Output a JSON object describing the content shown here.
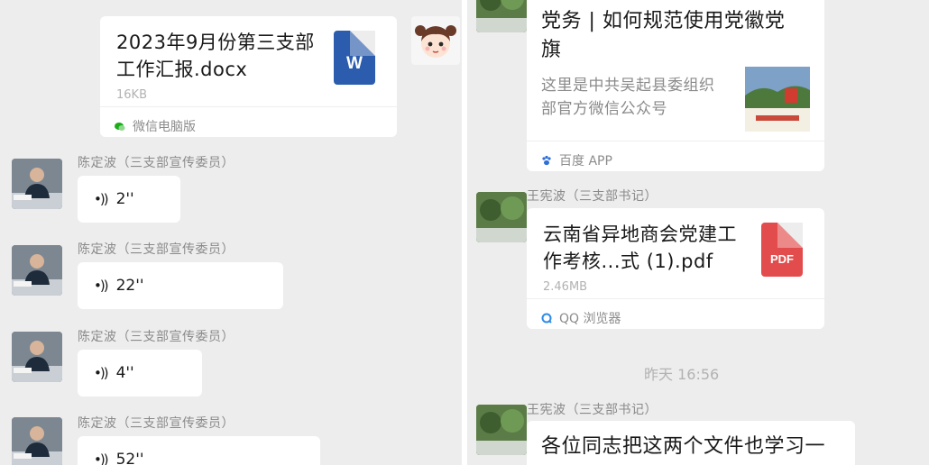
{
  "left_panel": {
    "file_message": {
      "file_name": "2023年9月份第三支部工作汇报.docx",
      "file_size": "16KB",
      "source_app": "微信电脑版",
      "file_type_glyph": "W",
      "file_icon_color": "#2b5cad",
      "source_icon": "wechat-icon"
    },
    "voice_messages": [
      {
        "sender": "陈定波（三支部宣传委员）",
        "duration": "2''"
      },
      {
        "sender": "陈定波（三支部宣传委员）",
        "duration": "22''"
      },
      {
        "sender": "陈定波（三支部宣传委员）",
        "duration": "4''"
      },
      {
        "sender": "陈定波（三支部宣传委员）",
        "duration": "52''"
      }
    ],
    "voice_icon": "voice-wave-icon"
  },
  "right_panel": {
    "link_message": {
      "title": "党务 | 如何规范使用党徽党旗",
      "description": "这里是中共吴起县委组织部官方微信公众号",
      "source_app": "百度 APP",
      "source_icon": "baidu-paw-icon"
    },
    "file_message": {
      "sender": "王宪波（三支部书记）",
      "file_name": "云南省异地商会党建工作考核...式 (1).pdf",
      "file_size": "2.46MB",
      "source_app": "QQ 浏览器",
      "file_type_glyph": "PDF",
      "file_icon_color": "#e34c4c",
      "source_icon": "qq-browser-icon"
    },
    "timestamp": "昨天 16:56",
    "text_message": {
      "sender": "王宪波（三支部书记）",
      "text": "各位同志把这两个文件也学习一"
    }
  }
}
